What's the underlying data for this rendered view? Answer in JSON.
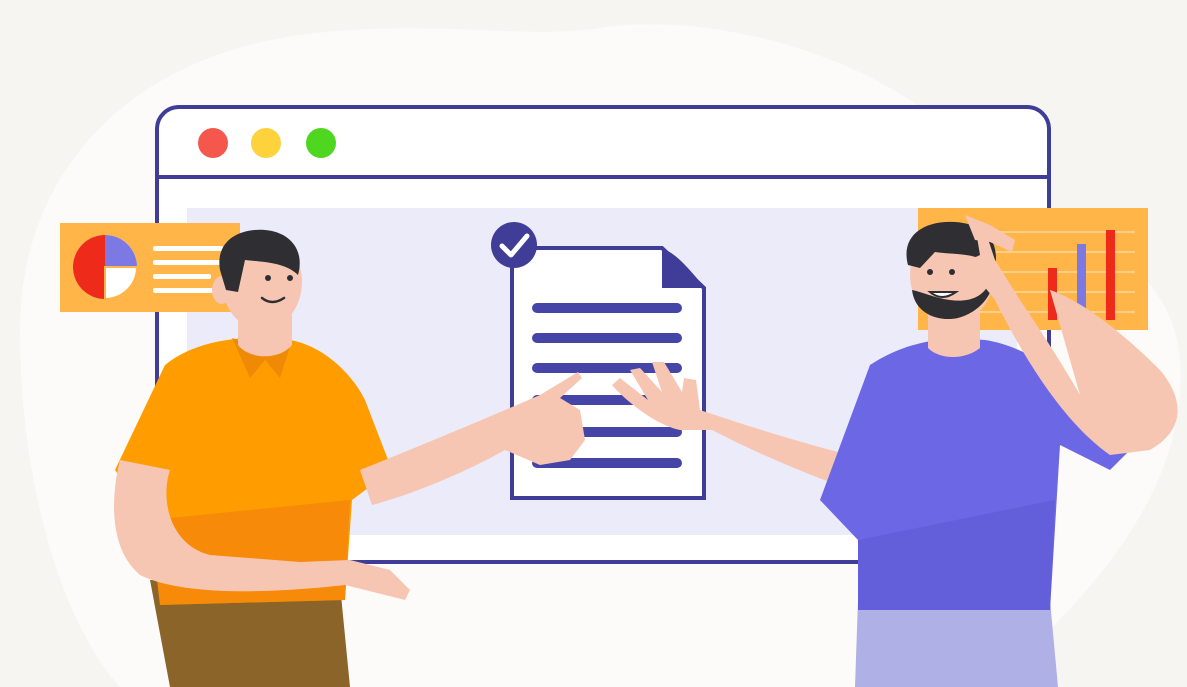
{
  "colors": {
    "background": "#f7f5f2",
    "blob": "#fdfbf9",
    "window_outline": "#3f3d97",
    "window_fill": "#ffffff",
    "content_area": "#ecebfa",
    "dot_red": "#f5574c",
    "dot_yellow": "#fdd23c",
    "dot_green": "#4fd61e",
    "accent_purple": "#4545a8",
    "card_orange": "#ffb547",
    "chart_red": "#ee2a1a",
    "chart_violet": "#7d79e4",
    "shirt_orange": "#ff9d00",
    "shirt_purple": "#6c67e4",
    "skin": "#f7c6b3",
    "hair": "#2f2e33",
    "pants_brown": "#8a6428",
    "pants_lavender": "#aeb0e6"
  },
  "icons": [
    "window-control-close-icon",
    "window-control-minimize-icon",
    "window-control-maximize-icon",
    "checkmark-badge-icon",
    "document-icon",
    "pie-chart-icon",
    "bar-chart-icon"
  ]
}
